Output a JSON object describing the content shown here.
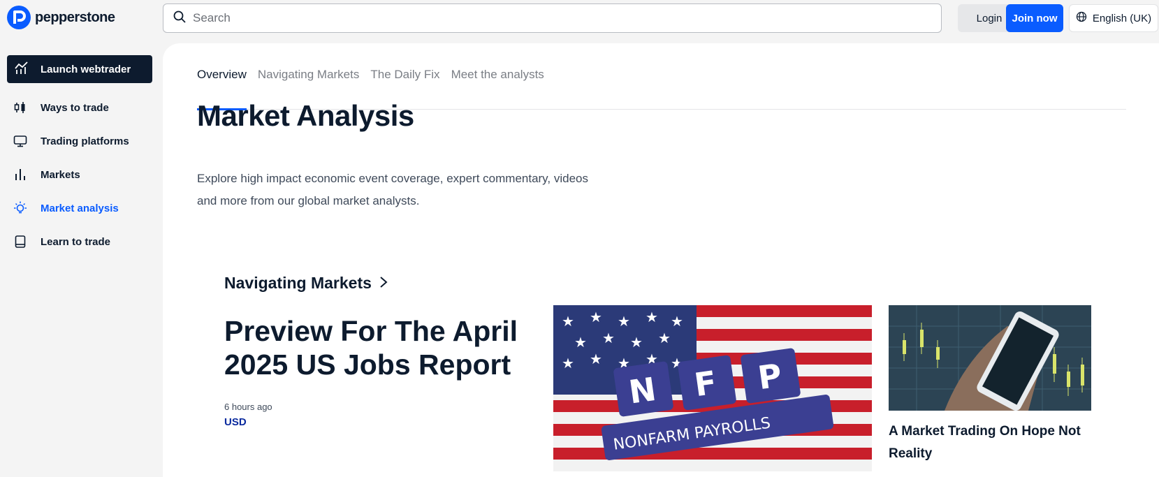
{
  "brand": {
    "name": "pepperstone"
  },
  "search": {
    "placeholder": "Search"
  },
  "header": {
    "login": "Login",
    "join": "Join now",
    "language": "English (UK)"
  },
  "sidebar": {
    "launch": "Launch webtrader",
    "items": [
      {
        "label": "Ways to trade",
        "icon": "candlestick-icon"
      },
      {
        "label": "Trading platforms",
        "icon": "monitor-icon"
      },
      {
        "label": "Markets",
        "icon": "bar-chart-icon"
      },
      {
        "label": "Market analysis",
        "icon": "lightbulb-icon",
        "active": true
      },
      {
        "label": "Learn to trade",
        "icon": "book-icon"
      }
    ]
  },
  "tabs": [
    {
      "label": "Overview",
      "active": true
    },
    {
      "label": "Navigating Markets"
    },
    {
      "label": "The Daily Fix"
    },
    {
      "label": "Meet the analysts"
    }
  ],
  "page": {
    "title": "Market Analysis",
    "description": "Explore high impact economic event coverage, expert commentary, videos and more from our global market analysts."
  },
  "section": {
    "title": "Navigating Markets",
    "featured": {
      "title": "Preview For The April 2025 US Jobs Report",
      "time": "6 hours ago",
      "tag": "USD",
      "image_text": {
        "letters": [
          "N",
          "F",
          "P"
        ],
        "caption": "NONFARM PAYROLLS"
      }
    },
    "secondary": {
      "title": "A Market Trading On Hope Not Reality"
    }
  },
  "colors": {
    "brand": "#0a5cff",
    "navy": "#0d1b2e",
    "tag": "#0a2a9e"
  }
}
